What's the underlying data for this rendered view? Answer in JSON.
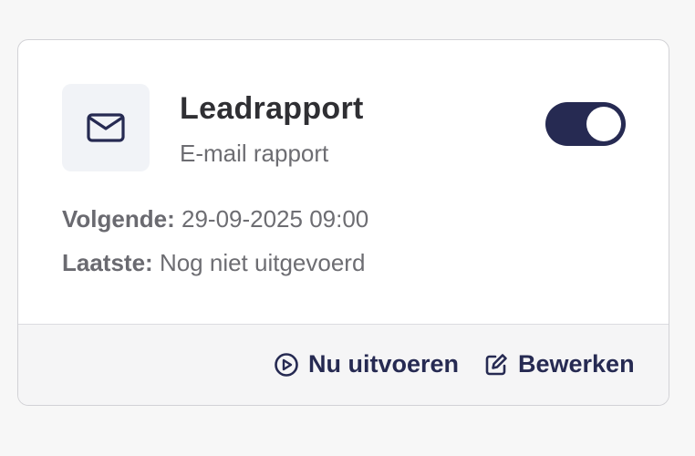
{
  "card": {
    "icon": "envelope-icon",
    "title": "Leadrapport",
    "subtitle": "E-mail rapport",
    "toggle": {
      "on": true,
      "color": "#262a52"
    },
    "next": {
      "label": "Volgende:",
      "value": "29-09-2025 09:00"
    },
    "last": {
      "label": "Laatste:",
      "value": "Nog niet uitgevoerd"
    },
    "actions": {
      "run": {
        "icon": "play-circle-icon",
        "label": "Nu uitvoeren"
      },
      "edit": {
        "icon": "edit-icon",
        "label": "Bewerken"
      }
    }
  }
}
